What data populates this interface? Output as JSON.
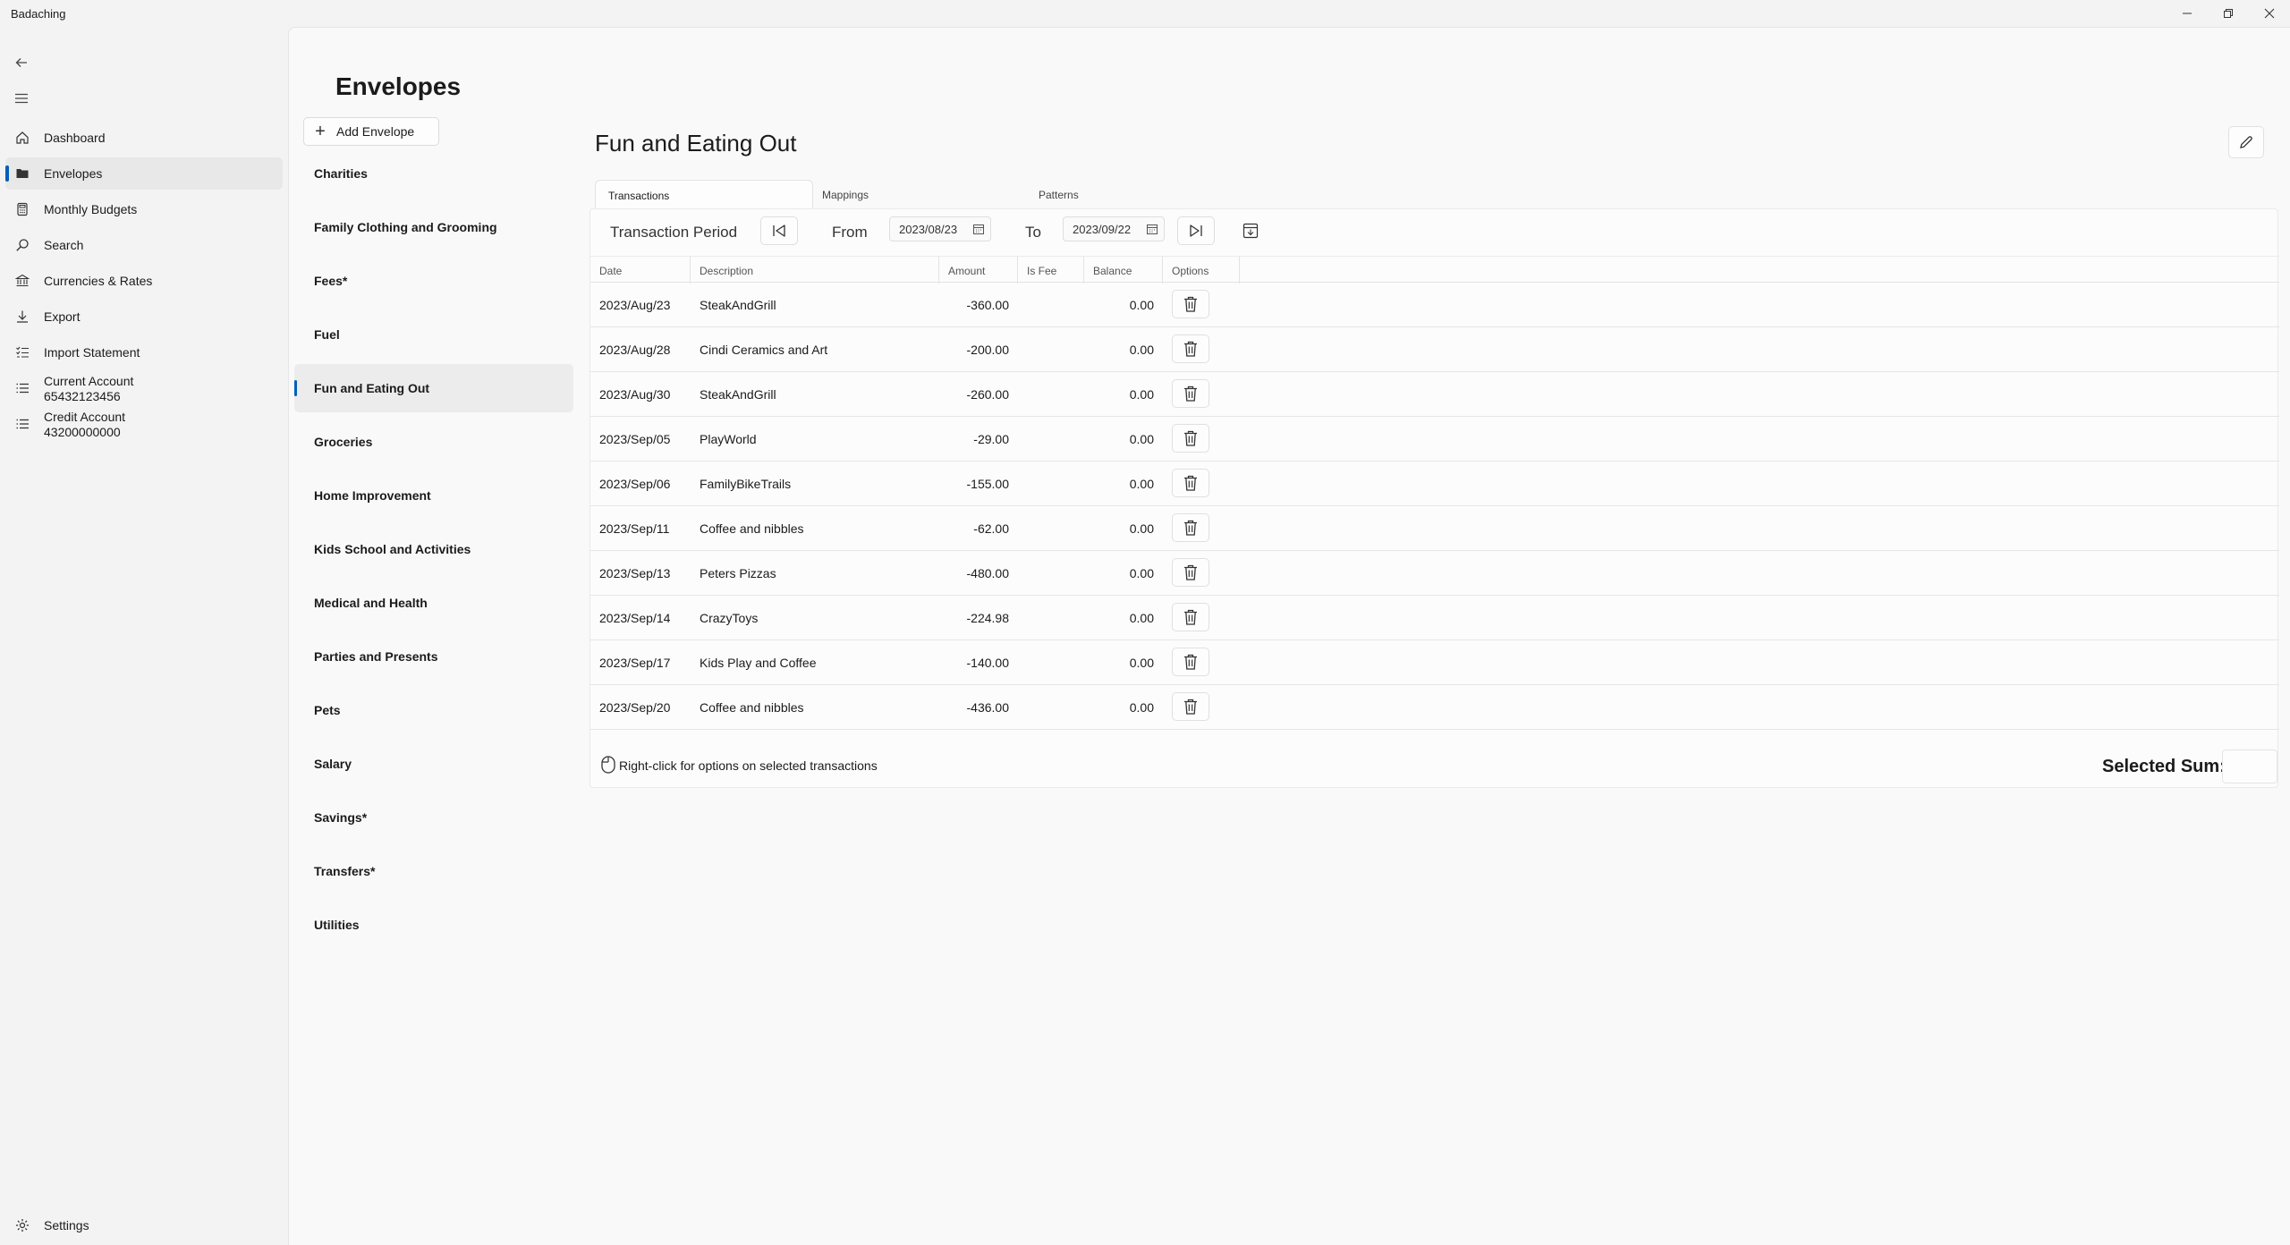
{
  "app": {
    "title": "Badaching"
  },
  "window_controls": {
    "minimize": "—",
    "maximize": "❐",
    "close": "✕"
  },
  "nav": {
    "items": [
      {
        "label": "Dashboard",
        "icon": "home-icon"
      },
      {
        "label": "Envelopes",
        "icon": "folder-icon",
        "selected": true
      },
      {
        "label": "Monthly Budgets",
        "icon": "calculator-icon"
      },
      {
        "label": "Search",
        "icon": "search-icon"
      },
      {
        "label": "Currencies & Rates",
        "icon": "bank-icon"
      },
      {
        "label": "Export",
        "icon": "download-icon"
      },
      {
        "label": "Import Statement",
        "icon": "checklist-icon"
      },
      {
        "label": "Current Account",
        "sublabel": "65432123456",
        "icon": "list-icon"
      },
      {
        "label": "Credit Account",
        "sublabel": "43200000000",
        "icon": "list-icon"
      }
    ],
    "settings_label": "Settings"
  },
  "page": {
    "title": "Envelopes"
  },
  "envelopes": {
    "add_label": "Add Envelope",
    "items": [
      "Charities",
      "Family Clothing and Grooming",
      "Fees*",
      "Fuel",
      "Fun and Eating Out",
      "Groceries",
      "Home Improvement",
      "Kids School and Activities",
      "Medical and Health",
      "Parties and Presents",
      "Pets",
      "Salary",
      "Savings*",
      "Transfers*",
      "Utilities"
    ],
    "selected": "Fun and Eating Out"
  },
  "detail": {
    "title": "Fun and Eating Out",
    "tabs": [
      "Transactions",
      "Mappings",
      "Patterns"
    ],
    "active_tab": "Transactions",
    "period": {
      "label": "Transaction Period",
      "from_label": "From",
      "from_value": "2023/08/23",
      "to_label": "To",
      "to_value": "2023/09/22"
    },
    "columns": [
      "Date",
      "Description",
      "Amount",
      "Is Fee",
      "Balance",
      "Options"
    ],
    "rows": [
      {
        "date": "2023/Aug/23",
        "description": "SteakAndGrill",
        "amount": "-360.00",
        "is_fee": "",
        "balance": "0.00"
      },
      {
        "date": "2023/Aug/28",
        "description": "Cindi Ceramics and Art",
        "amount": "-200.00",
        "is_fee": "",
        "balance": "0.00"
      },
      {
        "date": "2023/Aug/30",
        "description": "SteakAndGrill",
        "amount": "-260.00",
        "is_fee": "",
        "balance": "0.00"
      },
      {
        "date": "2023/Sep/05",
        "description": "PlayWorld",
        "amount": "-29.00",
        "is_fee": "",
        "balance": "0.00"
      },
      {
        "date": "2023/Sep/06",
        "description": "FamilyBikeTrails",
        "amount": "-155.00",
        "is_fee": "",
        "balance": "0.00"
      },
      {
        "date": "2023/Sep/11",
        "description": "Coffee and nibbles",
        "amount": "-62.00",
        "is_fee": "",
        "balance": "0.00"
      },
      {
        "date": "2023/Sep/13",
        "description": "Peters Pizzas",
        "amount": "-480.00",
        "is_fee": "",
        "balance": "0.00"
      },
      {
        "date": "2023/Sep/14",
        "description": "CrazyToys",
        "amount": "-224.98",
        "is_fee": "",
        "balance": "0.00"
      },
      {
        "date": "2023/Sep/17",
        "description": "Kids Play and Coffee",
        "amount": "-140.00",
        "is_fee": "",
        "balance": "0.00"
      },
      {
        "date": "2023/Sep/20",
        "description": "Coffee and nibbles",
        "amount": "-436.00",
        "is_fee": "",
        "balance": "0.00"
      }
    ],
    "footer": {
      "hint": "Right-click for options on selected transactions",
      "selected_sum_label": "Selected Sum:",
      "selected_sum_value": ""
    }
  },
  "colors": {
    "accent": "#005fb8"
  }
}
